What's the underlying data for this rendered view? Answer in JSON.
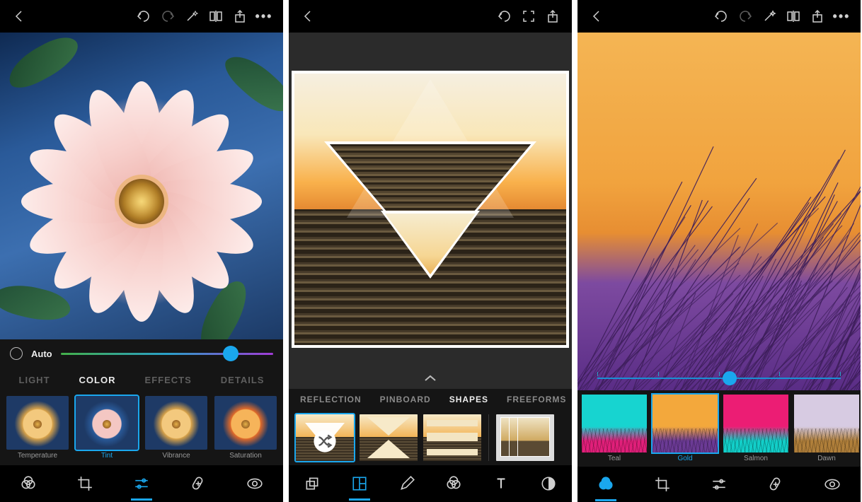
{
  "panel1": {
    "slider": {
      "auto_label": "Auto",
      "position": 0.8
    },
    "category_tabs": [
      {
        "label": "LIGHT",
        "active": false
      },
      {
        "label": "COLOR",
        "active": true
      },
      {
        "label": "EFFECTS",
        "active": false
      },
      {
        "label": "DETAILS",
        "active": false
      }
    ],
    "adjust_thumbs": [
      {
        "label": "Temperature",
        "selected": false,
        "tint": "warm"
      },
      {
        "label": "Tint",
        "selected": true,
        "tint": "cool"
      },
      {
        "label": "Vibrance",
        "selected": false,
        "tint": "warm"
      },
      {
        "label": "Saturation",
        "selected": false,
        "tint": "hot"
      }
    ],
    "bottom_active_index": 2
  },
  "panel2": {
    "mix_tabs": [
      {
        "label": "REFLECTION",
        "active": false
      },
      {
        "label": "PINBOARD",
        "active": false
      },
      {
        "label": "SHAPES",
        "active": true
      },
      {
        "label": "FREEFORMS",
        "active": false
      }
    ],
    "shape_thumbs": [
      {
        "kind": "shuffle",
        "selected": true
      },
      {
        "kind": "hourglass",
        "selected": false
      },
      {
        "kind": "bars",
        "selected": false
      },
      {
        "kind": "separator"
      },
      {
        "kind": "stack",
        "selected": false
      }
    ],
    "bottom_active_index": 1
  },
  "panel3": {
    "slider_position": 0.545,
    "presets": [
      {
        "label": "Teal",
        "selected": false,
        "sky": "#17d4d0",
        "ground": "#e11f7a"
      },
      {
        "label": "Gold",
        "selected": true,
        "sky": "#f3a83c",
        "ground": "#6b3a95"
      },
      {
        "label": "Salmon",
        "selected": false,
        "sky": "#ec1d74",
        "ground": "#12cfc9"
      },
      {
        "label": "Dawn",
        "selected": false,
        "sky": "#d7cbe2",
        "ground": "#b07f3a"
      }
    ],
    "bottom_active_index": 0
  }
}
